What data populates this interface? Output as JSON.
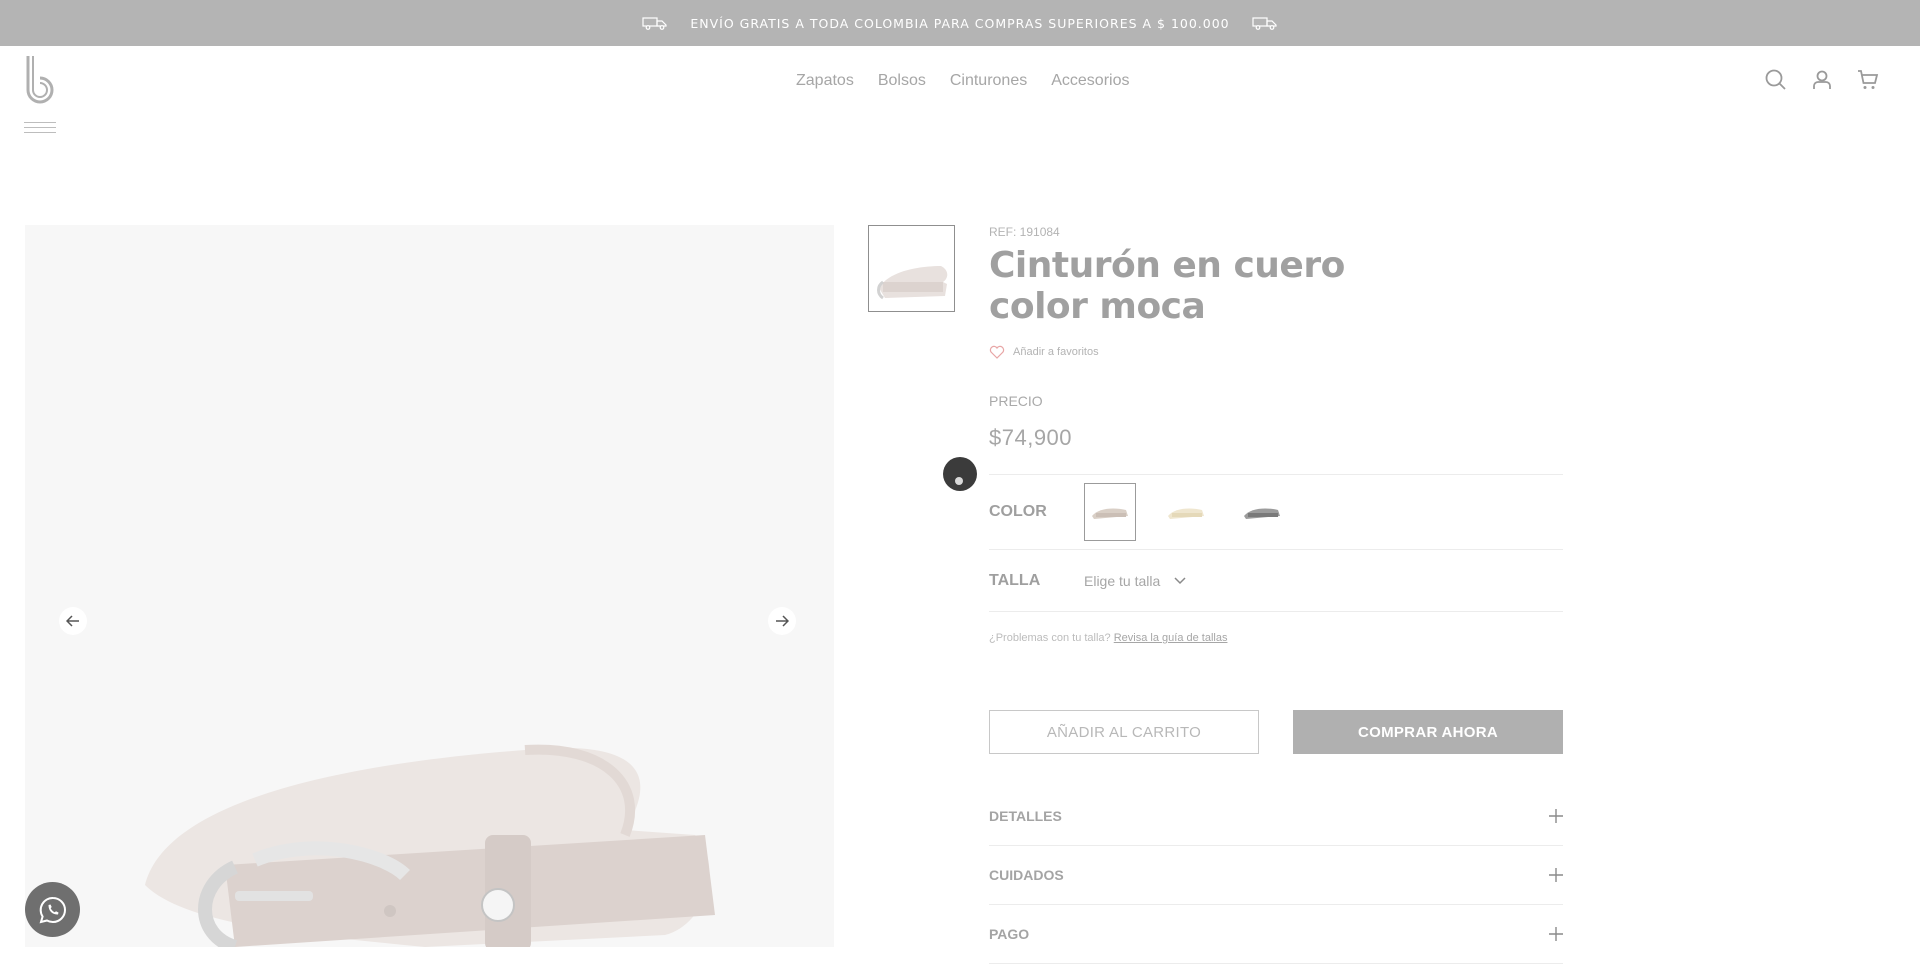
{
  "announcement": {
    "text": "ENVÍO GRATIS A TODA COLOMBIA PARA COMPRAS SUPERIORES A $ 100.000",
    "icon": "truck-icon"
  },
  "header": {
    "logo_icon": "brand-logo-b",
    "nav": [
      "Zapatos",
      "Bolsos",
      "Cinturones",
      "Accesorios"
    ],
    "icons": [
      "search-icon",
      "user-icon",
      "cart-icon"
    ]
  },
  "product": {
    "ref": "REF: 191084",
    "title": "Cinturón en cuero color moca",
    "favorite_label": "Añadir a favoritos",
    "price_label": "PRECIO",
    "price": "$74,900",
    "color_label": "COLOR",
    "colors": [
      {
        "name": "moca",
        "hex": "#d9cfc6",
        "selected": true
      },
      {
        "name": "beige",
        "hex": "#efe6cf",
        "selected": false
      },
      {
        "name": "gris",
        "hex": "#9c9c9c",
        "selected": false
      }
    ],
    "size_label": "TALLA",
    "size_placeholder": "Elige tu talla",
    "size_help_text": "¿Problemas con tu talla?",
    "size_help_link": "Revisa la guía de tallas",
    "add_to_cart": "AÑADIR AL CARRITO",
    "buy_now": "COMPRAR AHORA",
    "accordions": [
      "DETALLES",
      "CUIDADOS",
      "PAGO"
    ]
  },
  "colors": {
    "topbar": "#b4b4b4",
    "button_solid": "#b0b0b0",
    "whatsapp": "#6f6f6f"
  }
}
